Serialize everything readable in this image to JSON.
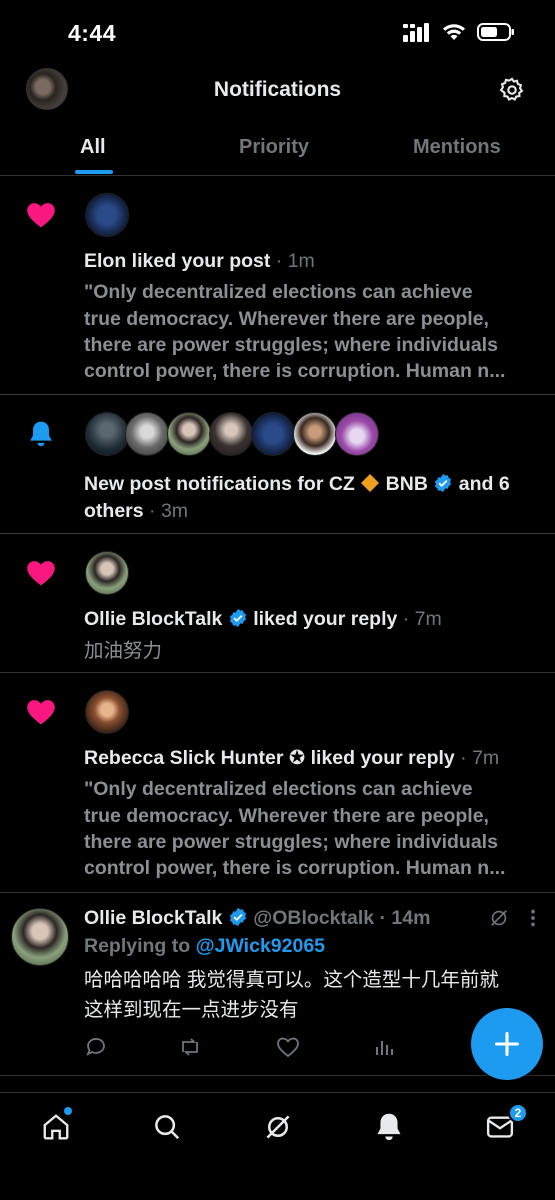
{
  "status_bar": {
    "time": "4:44"
  },
  "header": {
    "title": "Notifications"
  },
  "tabs": [
    {
      "label": "All"
    },
    {
      "label": "Priority"
    },
    {
      "label": "Mentions"
    }
  ],
  "notifications": [
    {
      "type": "like",
      "actor": "Elon",
      "action": " liked your post",
      "time": " · 1m",
      "body_lines": [
        "\"Only decentralized elections can achieve",
        "true democracy. Wherever there are people,",
        "there are power struggles; where individuals",
        "control power, there is corruption. Human n..."
      ]
    },
    {
      "type": "bell",
      "line1_pre": "New post notifications for CZ ",
      "line1_name": " BNB ",
      "line1_post": " and 6",
      "line2": "others",
      "time": " · 3m"
    },
    {
      "type": "like",
      "actor": "Ollie BlockTalk",
      "action": " liked your reply",
      "time": " · 7m",
      "body": "加油努力"
    },
    {
      "type": "like",
      "actor": "Rebecca Slick Hunter ✪",
      "action": " liked your reply",
      "time": " · 7m",
      "body_lines": [
        "\"Only decentralized elections can achieve",
        "true democracy. Wherever there are people,",
        "there are power struggles; where individuals",
        "control power, there is corruption. Human n..."
      ]
    }
  ],
  "reply": {
    "name": "Ollie BlockTalk",
    "handle": " @OBlocktalk",
    "time": " · 14m",
    "replying_prefix": "Replying to ",
    "replying_to": "@JWick92065",
    "body_lines": [
      "哈哈哈哈哈 我觉得真可以。这个造型十几年前就",
      "这样到现在一点进步没有"
    ]
  },
  "bottom_nav": {
    "messages_badge": "2"
  },
  "colors": {
    "accent": "#1d9bf0",
    "like": "#f91880",
    "background": "#000000"
  },
  "icons": [
    "heart-icon",
    "bell-icon",
    "verified-icon",
    "gear-icon",
    "home-icon",
    "search-icon",
    "grok-icon",
    "messages-icon",
    "plus-icon"
  ]
}
